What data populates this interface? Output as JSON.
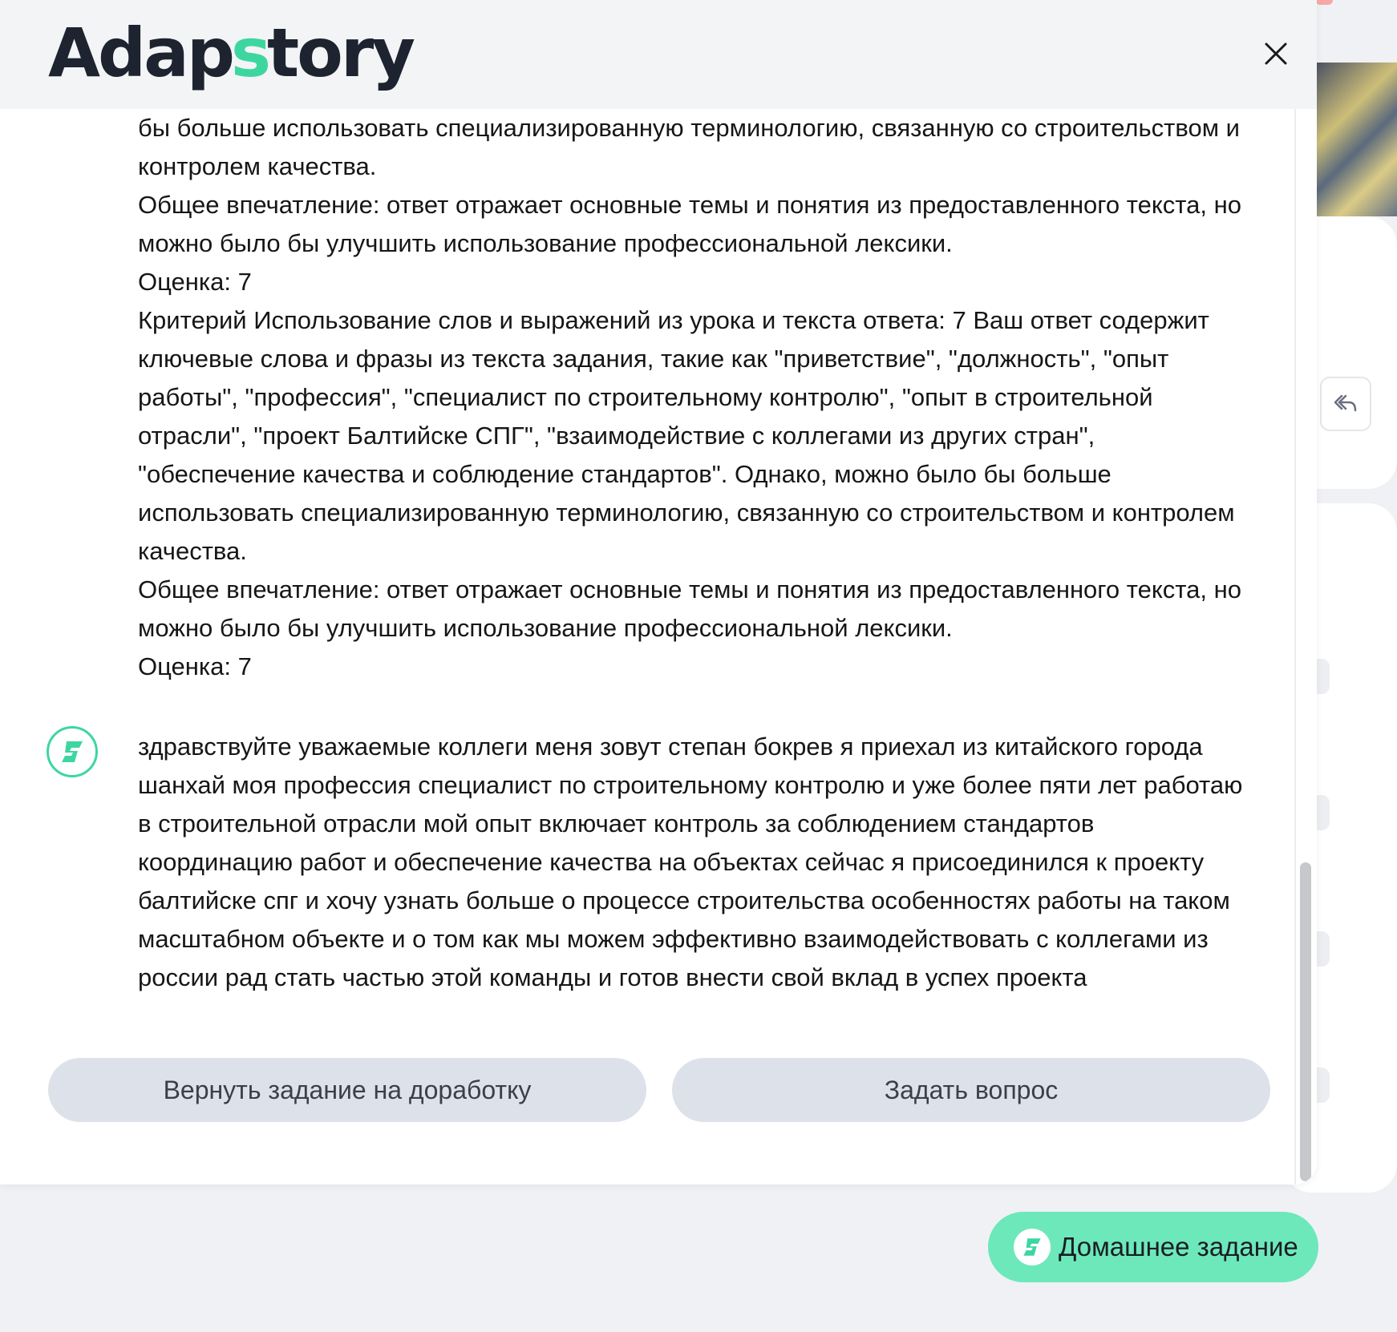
{
  "header": {
    "logo_left": "Adap",
    "logo_mark": "s",
    "logo_right": "tory"
  },
  "feedback": {
    "paragraphs": [
      "бы больше использовать специализированную терминологию, связанную со строительством и контролем качества.",
      "Общее впечатление: ответ отражает основные темы и понятия из предоставленного текста, но можно было бы улучшить использование профессиональной лексики.",
      "Оценка: 7",
      "Критерий Использование слов и выражений из урока и текста ответа: 7 Ваш ответ содержит ключевые слова и фразы из текста задания, такие как \"приветствие\", \"должность\", \"опыт работы\", \"профессия\", \"специалист по строительному контролю\", \"опыт в строительной отрасли\", \"проект Балтийске СПГ\", \"взаимодействие с коллегами из других стран\", \"обеспечение качества и соблюдение стандартов\". Однако, можно было бы больше использовать специализированную терминологию, связанную со строительством и контролем качества.",
      "Общее впечатление: ответ отражает основные темы и понятия из предоставленного текста, но можно было бы улучшить использование профессиональной лексики.",
      "Оценка: 7"
    ]
  },
  "student_message": {
    "text": "здравствуйте уважаемые коллеги меня зовут степан бокрев я приехал из китайского города шанхай моя профессия специалист по строительному контролю и уже более пяти лет работаю в строительной отрасли мой опыт включает контроль за соблюдением стандартов координацию работ и обеспечение качества на объектах сейчас я присоединился к проекту балтийске спг и хочу узнать больше о процессе строительства особенностях работы на таком масштабном объекте и о том как мы можем эффективно взаимодействовать с коллегами из россии рад стать частью этой команды и готов внести свой вклад в успех проекта"
  },
  "actions": {
    "return_label": "Вернуть задание на доработку",
    "ask_label": "Задать вопрос"
  },
  "floating": {
    "homework_label": "Домашнее задание"
  },
  "colors": {
    "accent": "#3ed6a0",
    "homework_bg": "#6de8bb",
    "button_bg": "#dde1e9"
  }
}
